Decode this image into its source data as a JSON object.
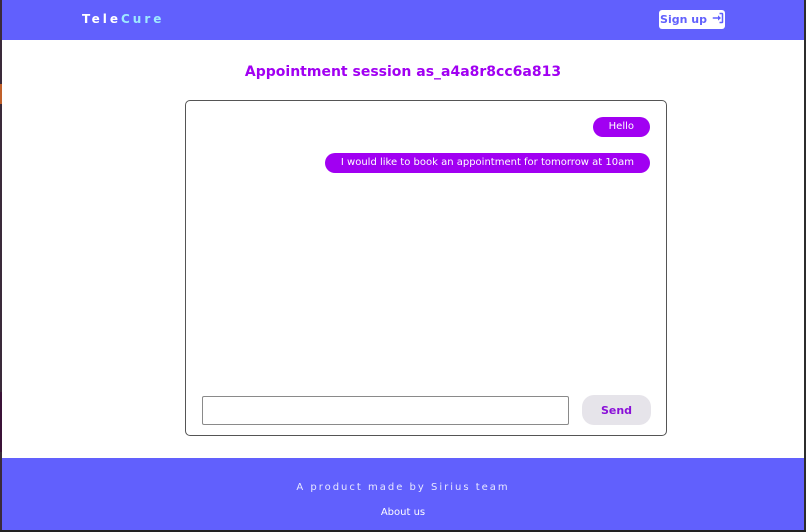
{
  "navbar": {
    "brand_part1": "Tele",
    "brand_part2": "Cure",
    "signup_label": "Sign up",
    "signup_icon": "sign-in-icon",
    "background": "#6160fd"
  },
  "page": {
    "title": "Appointment session as_a4a8r8cc6a813",
    "title_color": "#a100f2"
  },
  "chat": {
    "messages": [
      {
        "text": "Hello"
      },
      {
        "text": "I would like to book an appointment for tomorrow at 10am"
      }
    ],
    "input_value": "",
    "input_placeholder": "",
    "send_label": "Send",
    "bubble_color": "#a100f2"
  },
  "footer": {
    "tagline": "A product made by Sirius team",
    "about_label": "About us",
    "background": "#6160fd"
  }
}
